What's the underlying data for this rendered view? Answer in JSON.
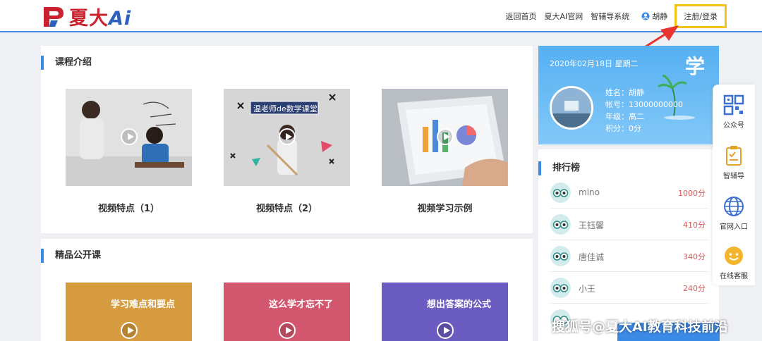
{
  "header": {
    "logo_text_cn": "夏大",
    "logo_text_ai": "Ai",
    "nav": [
      "返回首页",
      "夏大AI官网",
      "智辅导系统"
    ],
    "user_name": "胡静",
    "login_label": "注册/登录"
  },
  "course_intro": {
    "title": "课程介绍",
    "videos": [
      {
        "caption": "视频特点（1）"
      },
      {
        "caption": "视频特点（2）",
        "board_text": "温老师de数学课堂"
      },
      {
        "caption": "视频学习示例"
      }
    ]
  },
  "open_course": {
    "title": "精品公开课",
    "videos": [
      {
        "overlay": "学习难点和要点",
        "color": "#d69b3f"
      },
      {
        "overlay": "这么学才忘不了",
        "color": "#d2566e"
      },
      {
        "overlay": "想出答案的公式",
        "color": "#6a5cc0"
      }
    ]
  },
  "profile": {
    "date": "2020年02月18日 星期二",
    "xue": "学",
    "name_line": "姓名：胡静",
    "account_line": "帐号：13000000000",
    "grade_line": "年级：高二",
    "points_line": "积分：0分"
  },
  "ranking": {
    "title": "排行榜",
    "rows": [
      {
        "name": "mino",
        "score": "1000分"
      },
      {
        "name": "王钰馨",
        "score": "410分"
      },
      {
        "name": "唐佳诚",
        "score": "340分"
      },
      {
        "name": "小王",
        "score": "240分"
      }
    ]
  },
  "side": {
    "items": [
      "公众号",
      "智辅导",
      "官网入口",
      "在线客服"
    ]
  },
  "watermark": "搜狐号@夏大AI教育科技前沿",
  "colors": {
    "accent": "#3b8ae6",
    "highlight": "#f5c21a",
    "arrow": "#e8332e"
  }
}
